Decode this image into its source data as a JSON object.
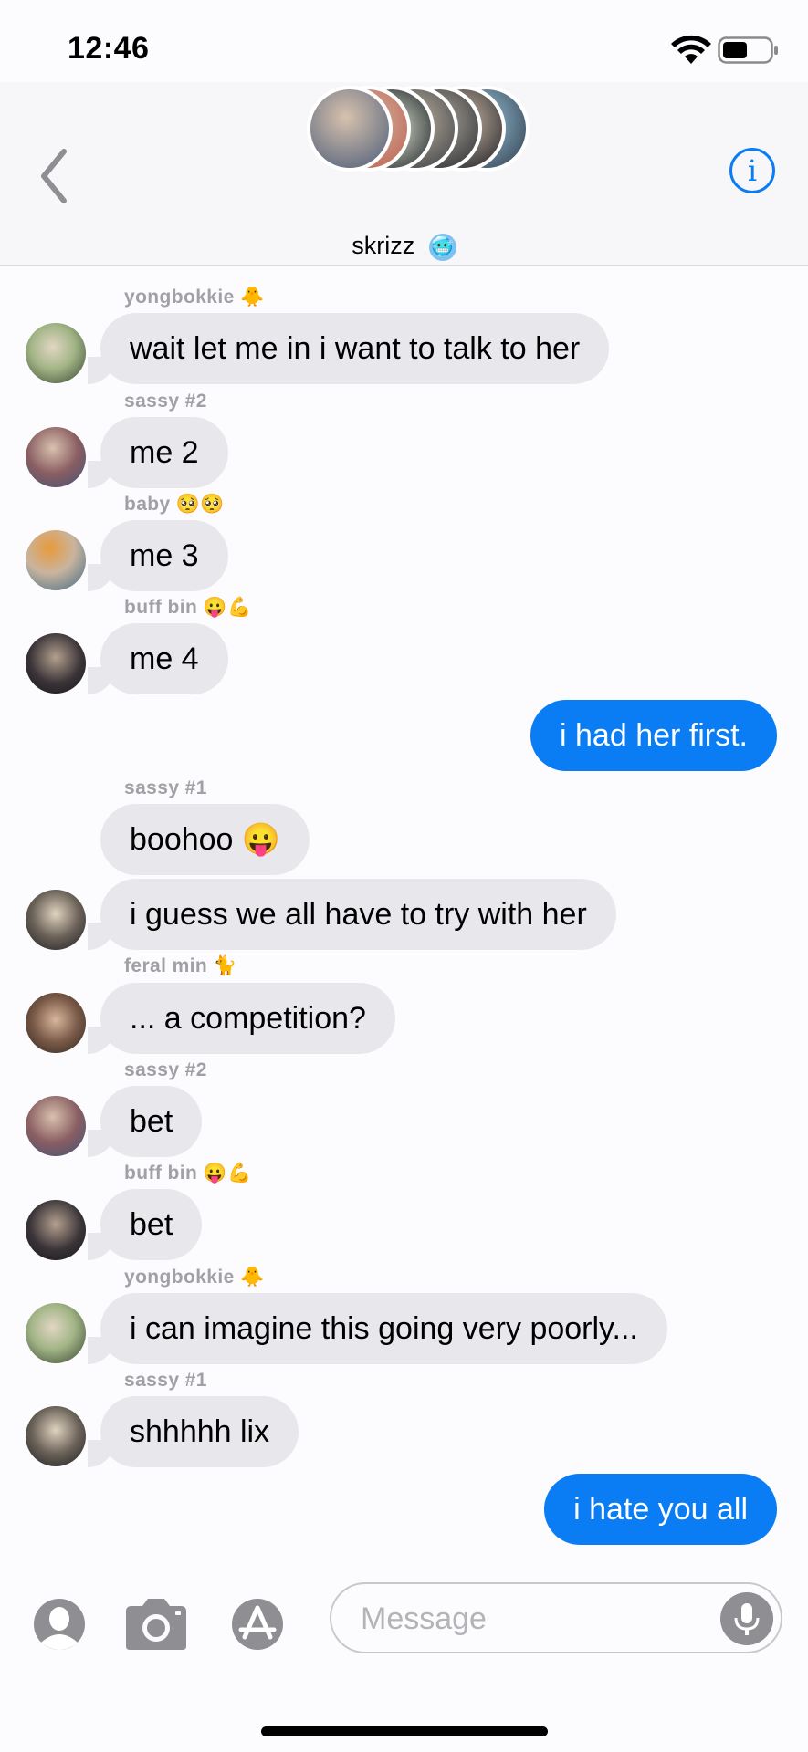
{
  "status": {
    "time": "12:46"
  },
  "header": {
    "group_name": "skrizz",
    "group_emoji": "🥶",
    "info_label": "i"
  },
  "messages": [
    {
      "sender": "yongbokkie",
      "sender_emoji": "🐥",
      "text": "wait let me in i want to talk to her"
    },
    {
      "sender": "sassy #2",
      "sender_emoji": "",
      "text": "me 2"
    },
    {
      "sender": "baby",
      "sender_emoji": "🥺🥺",
      "text": "me 3"
    },
    {
      "sender": "buff bin",
      "sender_emoji": "😛💪",
      "text": "me 4"
    },
    {
      "sender": "",
      "sender_emoji": "",
      "text": "i had her first."
    },
    {
      "sender": "sassy #1",
      "sender_emoji": "",
      "text": "boohoo 😛"
    },
    {
      "sender": "",
      "sender_emoji": "",
      "text": "i guess we all have to try with her"
    },
    {
      "sender": "feral min",
      "sender_emoji": "🐈",
      "text": "... a competition?"
    },
    {
      "sender": "sassy #2",
      "sender_emoji": "",
      "text": "bet"
    },
    {
      "sender": "buff bin",
      "sender_emoji": "😛💪",
      "text": "bet"
    },
    {
      "sender": "yongbokkie",
      "sender_emoji": "🐥",
      "text": "i can imagine this going very poorly..."
    },
    {
      "sender": "sassy #1",
      "sender_emoji": "",
      "text": "shhhhh lix"
    },
    {
      "sender": "",
      "sender_emoji": "",
      "text": "i hate you all"
    }
  ],
  "composer": {
    "placeholder": "Message"
  },
  "colors": {
    "outgoing": "#0a7cf4",
    "incoming": "#e8e7ec"
  }
}
